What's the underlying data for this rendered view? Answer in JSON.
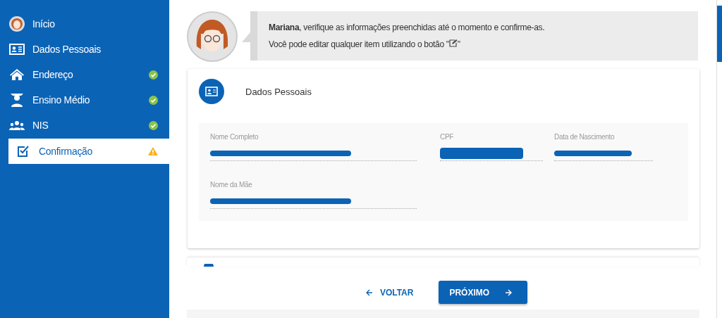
{
  "sidebar": {
    "items": [
      {
        "label": "Início",
        "kind": "avatar",
        "complete": false,
        "pending": false,
        "selected": false
      },
      {
        "label": "Dados Pessoais",
        "kind": "card",
        "complete": false,
        "pending": false,
        "selected": false
      },
      {
        "label": "Endereço",
        "kind": "home",
        "complete": true,
        "pending": false,
        "selected": false
      },
      {
        "label": "Ensino Médio",
        "kind": "graduate",
        "complete": true,
        "pending": false,
        "selected": false
      },
      {
        "label": "NIS",
        "kind": "people",
        "complete": true,
        "pending": false,
        "selected": false
      },
      {
        "label": "Confirmação",
        "kind": "checklist",
        "complete": false,
        "pending": true,
        "selected": true
      }
    ]
  },
  "message": {
    "name": "Mariana",
    "line_1": ", verifique as informações preenchidas até o momento e confirme-as.",
    "line_2_before": "Você pode editar qualquer item utilizando o botão \"",
    "line_2_after": "\""
  },
  "card": {
    "title": "Dados Pessoais",
    "fields": [
      {
        "label": "Nome Completo",
        "redacted": true
      },
      {
        "label": "CPF",
        "redacted": true
      },
      {
        "label": "Data de Nascimento",
        "redacted": true
      },
      {
        "label": "Nome da Mãe",
        "redacted": true
      }
    ]
  },
  "buttons": {
    "back": "VOLTAR",
    "next": "PRÓXIMO"
  }
}
